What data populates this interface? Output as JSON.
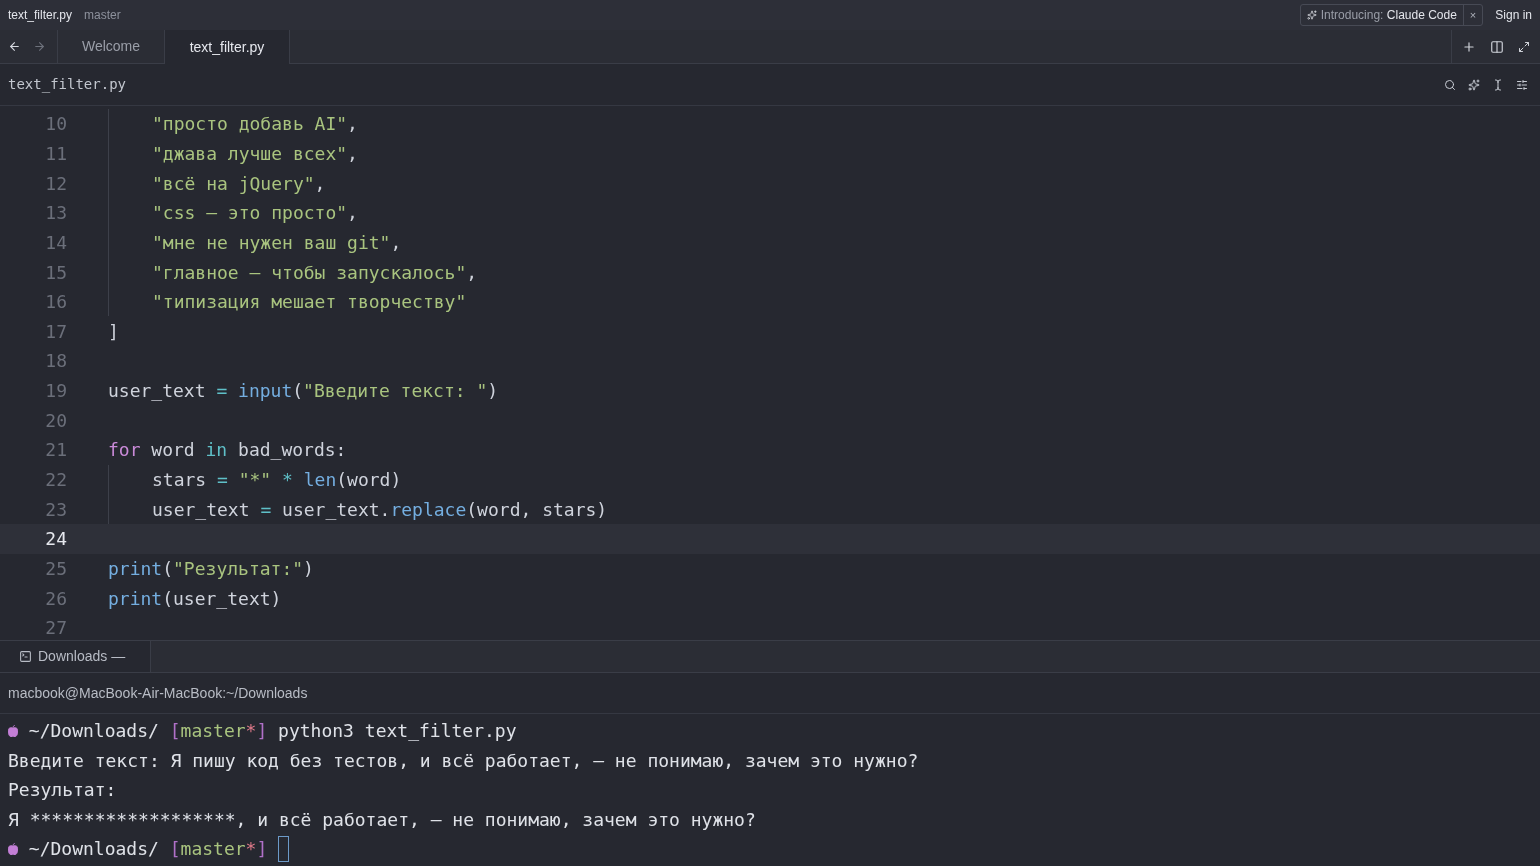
{
  "title_bar": {
    "file": "text_filter.py",
    "branch": "master",
    "promo": {
      "label": "Introducing:",
      "product": "Claude Code",
      "close": "×"
    },
    "sign_in": "Sign in"
  },
  "tabs": [
    {
      "label": "Welcome",
      "selected": false
    },
    {
      "label": "text_filter.py",
      "selected": true
    }
  ],
  "breadcrumb": "text_filter.py",
  "code_lines": [
    {
      "number": "10",
      "indented": true,
      "selected": false,
      "tokens": [
        {
          "kind": "string",
          "text": "\"просто добавь AI\""
        },
        {
          "kind": "plain",
          "text": ","
        }
      ]
    },
    {
      "number": "11",
      "indented": true,
      "selected": false,
      "tokens": [
        {
          "kind": "string",
          "text": "\"джава лучше всех\""
        },
        {
          "kind": "plain",
          "text": ","
        }
      ]
    },
    {
      "number": "12",
      "indented": true,
      "selected": false,
      "tokens": [
        {
          "kind": "string",
          "text": "\"всё на jQuery\""
        },
        {
          "kind": "plain",
          "text": ","
        }
      ]
    },
    {
      "number": "13",
      "indented": true,
      "selected": false,
      "tokens": [
        {
          "kind": "string",
          "text": "\"css — это просто\""
        },
        {
          "kind": "plain",
          "text": ","
        }
      ]
    },
    {
      "number": "14",
      "indented": true,
      "selected": false,
      "tokens": [
        {
          "kind": "string",
          "text": "\"мне не нужен ваш git\""
        },
        {
          "kind": "plain",
          "text": ","
        }
      ]
    },
    {
      "number": "15",
      "indented": true,
      "selected": false,
      "tokens": [
        {
          "kind": "string",
          "text": "\"главное — чтобы запускалось\""
        },
        {
          "kind": "plain",
          "text": ","
        }
      ]
    },
    {
      "number": "16",
      "indented": true,
      "selected": false,
      "tokens": [
        {
          "kind": "string",
          "text": "\"типизация мешает творчеству\""
        }
      ]
    },
    {
      "number": "17",
      "indented": false,
      "selected": false,
      "tokens": [
        {
          "kind": "plain",
          "text": "]"
        }
      ]
    },
    {
      "number": "18",
      "indented": false,
      "selected": false
    },
    {
      "number": "19",
      "indented": false,
      "selected": false,
      "tokens": [
        {
          "kind": "plain",
          "text": "user_text"
        },
        {
          "kind": "op",
          "text": "="
        },
        {
          "kind": "func",
          "text": "input"
        },
        {
          "kind": "plain",
          "text": "("
        },
        {
          "kind": "string",
          "text": "\"Введите текст: \""
        },
        {
          "kind": "plain",
          "text": ")"
        }
      ]
    },
    {
      "number": "20",
      "indented": false,
      "selected": false
    },
    {
      "number": "21",
      "indented": false,
      "selected": false,
      "tokens": [
        {
          "kind": "keyword",
          "text": "for"
        },
        {
          "kind": "plain",
          "text": "word"
        },
        {
          "kind": "op",
          "text": "in"
        },
        {
          "kind": "plain",
          "text": "bad_words:"
        }
      ]
    },
    {
      "number": "22",
      "indented": true,
      "selected": false,
      "tokens": [
        {
          "kind": "plain",
          "text": "stars"
        },
        {
          "kind": "op",
          "text": "="
        },
        {
          "kind": "string",
          "text": "\"*\""
        },
        {
          "kind": "op",
          "text": "*"
        },
        {
          "kind": "func",
          "text": "len"
        },
        {
          "kind": "plain",
          "text": "(word)"
        }
      ]
    },
    {
      "number": "23",
      "indented": true,
      "selected": false,
      "tokens": [
        {
          "kind": "plain",
          "text": "user_text"
        },
        {
          "kind": "op",
          "text": "="
        },
        {
          "kind": "plain",
          "text": "user_text."
        },
        {
          "kind": "func",
          "text": "replace"
        },
        {
          "kind": "plain",
          "text": "(word, stars)"
        }
      ]
    },
    {
      "number": "24",
      "indented": false,
      "selected": true
    },
    {
      "number": "25",
      "indented": false,
      "selected": false,
      "tokens": [
        {
          "kind": "func",
          "text": "print"
        },
        {
          "kind": "plain",
          "text": "("
        },
        {
          "kind": "string",
          "text": "\"Результат:\""
        },
        {
          "kind": "plain",
          "text": ")"
        }
      ]
    },
    {
      "number": "26",
      "indented": false,
      "selected": false,
      "tokens": [
        {
          "kind": "func",
          "text": "print"
        },
        {
          "kind": "plain",
          "text": "(user_text)"
        }
      ]
    },
    {
      "number": "27",
      "indented": false,
      "selected": false
    }
  ],
  "terminal": {
    "tab": "Downloads —",
    "header": "macbook@MacBook-Air-MacBook:~/Downloads",
    "lines": [
      {
        "kind": "prompt",
        "path": "~/Downloads/",
        "branch": {
          "open": "[",
          "name": "master",
          "dirty": "*",
          "close": "]"
        },
        "command": "python3 text_filter.py",
        "cursor": false
      },
      {
        "kind": "output",
        "text": "Введите текст: Я пишу код без тестов, и всё работает, — не понимаю, зачем это нужно?"
      },
      {
        "kind": "output",
        "text": "Результат:"
      },
      {
        "kind": "output",
        "text": "Я *******************, и всё работает, — не понимаю, зачем это нужно?"
      },
      {
        "kind": "prompt",
        "path": "~/Downloads/",
        "branch": {
          "open": "[",
          "name": "master",
          "dirty": "*",
          "close": "]"
        },
        "cursor": true
      }
    ]
  }
}
